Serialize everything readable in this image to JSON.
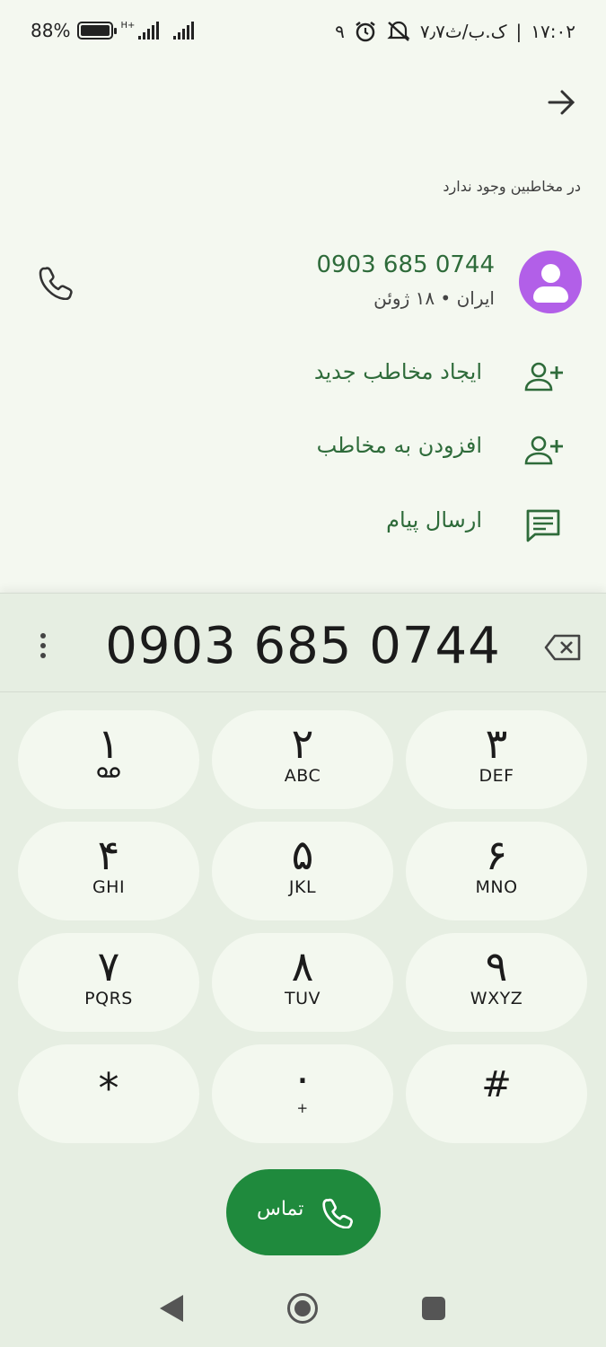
{
  "status_bar": {
    "battery_percent": "88%",
    "network_label": "H+",
    "time": "۱۷:۰۲",
    "data_speed": "۷٫۷ک.ب/ث",
    "notification_count": "۹",
    "icons": [
      "battery-icon",
      "signal-icon",
      "alarm-icon",
      "mute-icon"
    ]
  },
  "header": {
    "back_icon": "arrow-icon",
    "not_in_contacts": "در مخاطبین وجود ندارد"
  },
  "contact": {
    "number": "0903 685 0744",
    "subtitle": "ایران • ۱۸ ژوئن",
    "avatar_color": "#b25fe8"
  },
  "actions": [
    {
      "label": "ایجاد مخاطب جدید",
      "icon": "person-add-icon"
    },
    {
      "label": "افزودن به مخاطب",
      "icon": "person-add-icon"
    },
    {
      "label": "ارسال پیام",
      "icon": "message-icon"
    }
  ],
  "dialpad": {
    "display": "0903 685 0744",
    "keys": [
      {
        "digit": "۱",
        "letters": ""
      },
      {
        "digit": "۲",
        "letters": "ABC"
      },
      {
        "digit": "۳",
        "letters": "DEF"
      },
      {
        "digit": "۴",
        "letters": "GHI"
      },
      {
        "digit": "۵",
        "letters": "JKL"
      },
      {
        "digit": "۶",
        "letters": "MNO"
      },
      {
        "digit": "۷",
        "letters": "PQRS"
      },
      {
        "digit": "۸",
        "letters": "TUV"
      },
      {
        "digit": "۹",
        "letters": "WXYZ"
      },
      {
        "digit": "*",
        "letters": ""
      },
      {
        "digit": "۰",
        "letters": "+"
      },
      {
        "digit": "#",
        "letters": ""
      }
    ],
    "call_label": "تماس"
  },
  "colors": {
    "accent_green": "#2e6b3a",
    "call_button": "#1f8a3d",
    "background": "#f4f8f0"
  }
}
